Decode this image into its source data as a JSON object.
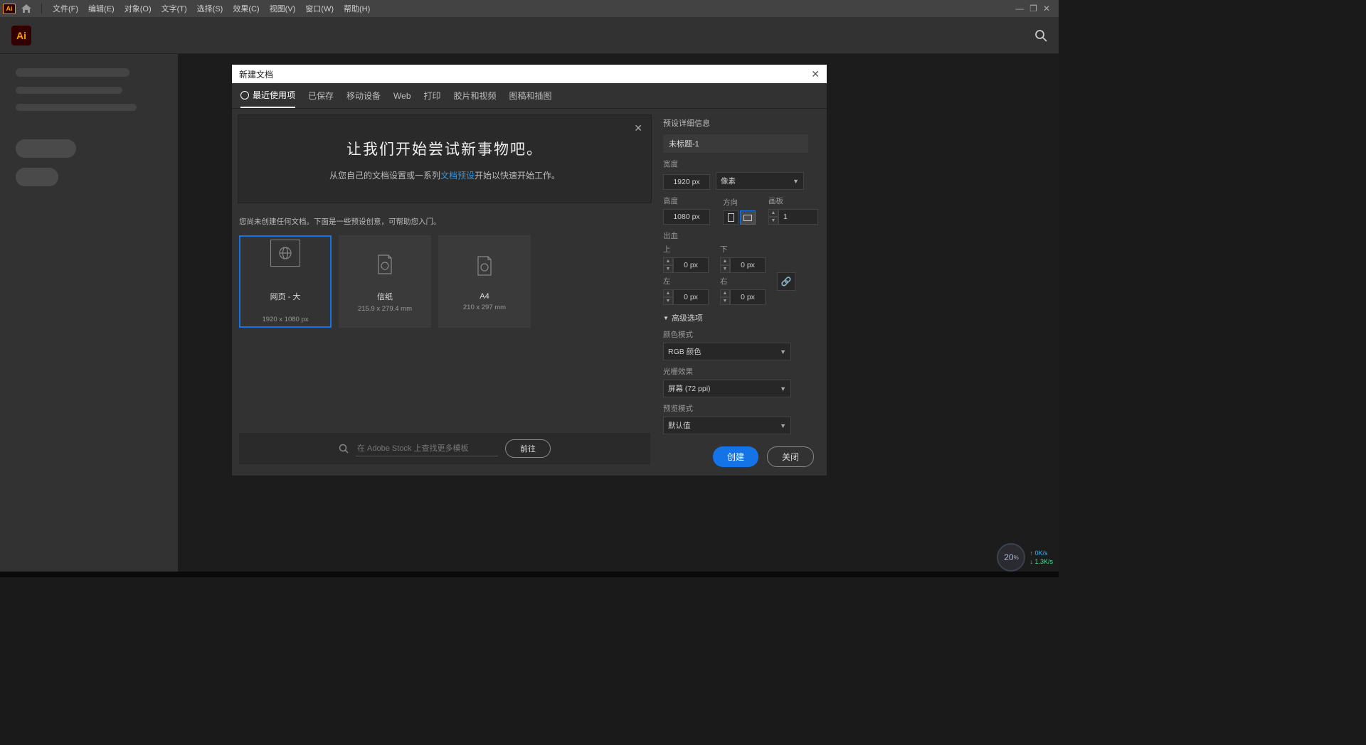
{
  "menubar": {
    "items": [
      "文件(F)",
      "编辑(E)",
      "对象(O)",
      "文字(T)",
      "选择(S)",
      "效果(C)",
      "视图(V)",
      "窗口(W)",
      "帮助(H)"
    ]
  },
  "dialog": {
    "title": "新建文档",
    "tabs": [
      "最近使用项",
      "已保存",
      "移动设备",
      "Web",
      "打印",
      "胶片和视频",
      "图稿和插图"
    ],
    "hero_title": "让我们开始尝试新事物吧。",
    "hero_sub_a": "从您自己的文档设置或一系列",
    "hero_sub_link": "文档预设",
    "hero_sub_b": "开始以快速开始工作。",
    "hint": "您尚未创建任何文档。下面是一些预设创意，可帮助您入门。",
    "presets": [
      {
        "name": "网页 - 大",
        "size": "1920 x 1080 px"
      },
      {
        "name": "信纸",
        "size": "215.9 x 279.4 mm"
      },
      {
        "name": "A4",
        "size": "210 x 297 mm"
      }
    ],
    "stock_placeholder": "在 Adobe Stock 上查找更多模板",
    "stock_go": "前往"
  },
  "details": {
    "section": "预设详细信息",
    "name": "未标题-1",
    "width_label": "宽度",
    "width": "1920 px",
    "unit": "像素",
    "height_label": "高度",
    "height": "1080 px",
    "orient_label": "方向",
    "artboard_label": "画板",
    "artboards": "1",
    "bleed_label": "出血",
    "top": "上",
    "bottom": "下",
    "left": "左",
    "right": "右",
    "bleed_val": "0 px",
    "advanced": "高级选项",
    "colormode_label": "颜色模式",
    "colormode": "RGB 颜色",
    "raster_label": "光栅效果",
    "raster": "屏幕 (72 ppi)",
    "preview_label": "预览模式",
    "preview": "默认值",
    "create": "创建",
    "close": "关闭"
  },
  "net": {
    "pct": "20",
    "up": "0K/s",
    "dn": "1.3K/s"
  }
}
